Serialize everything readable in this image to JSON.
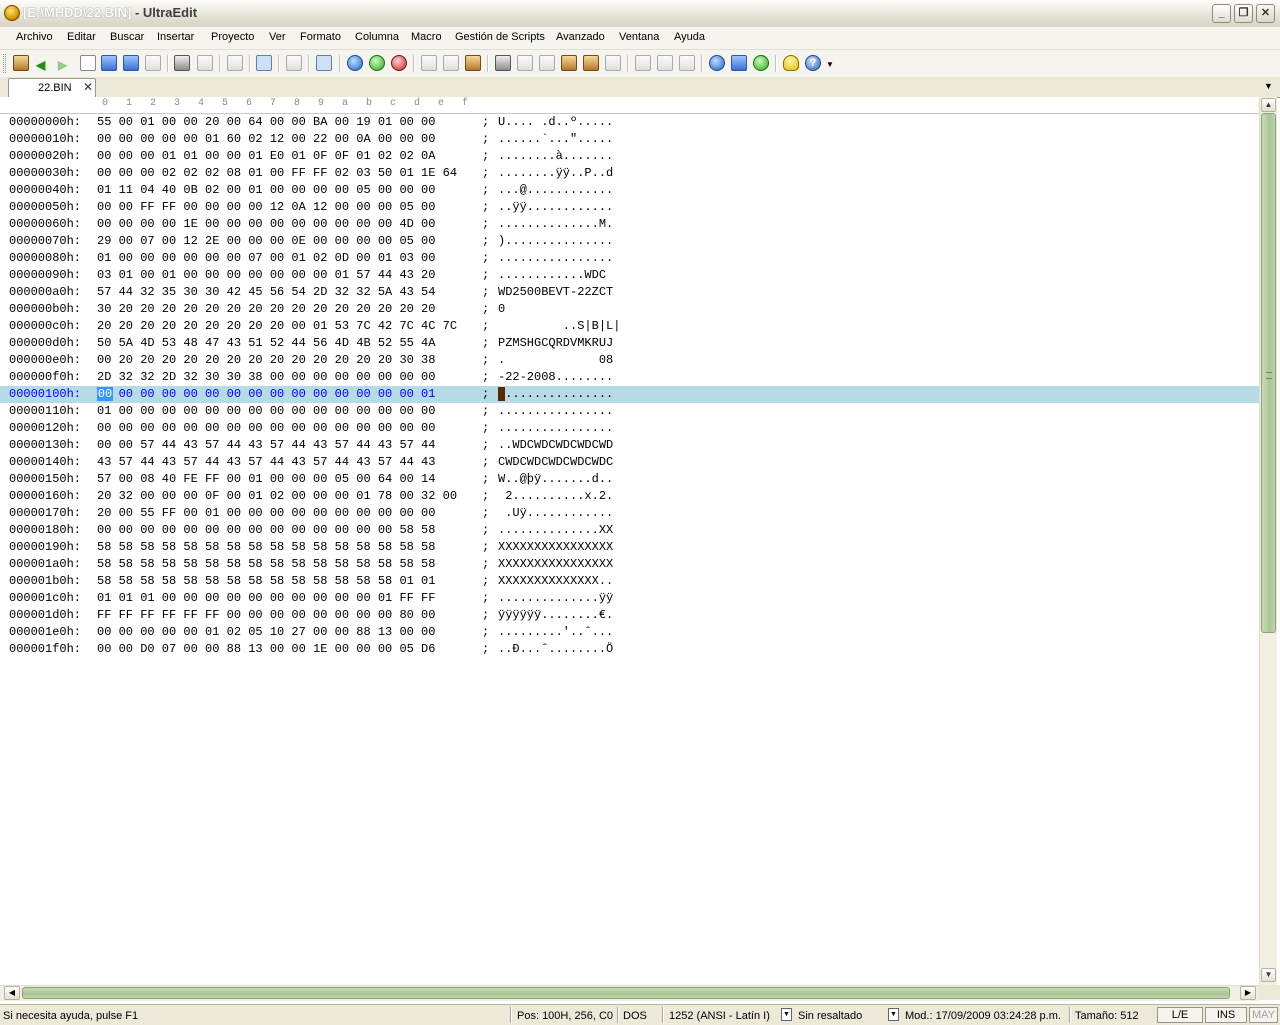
{
  "window": {
    "title_path": "[E:\\MHDD\\22.BIN]",
    "title_app": " - UltraEdit",
    "min_glyph": "_",
    "max_glyph": "❐",
    "close_glyph": "✕"
  },
  "menu": [
    "Archivo",
    "Editar",
    "Buscar",
    "Insertar",
    "Proyecto",
    "Ver",
    "Formato",
    "Columna",
    "Macro",
    "Gestión de Scripts",
    "Avanzado",
    "Ventana",
    "Ayuda"
  ],
  "tab": {
    "label": "22.BIN",
    "close": "✕"
  },
  "ruler": [
    "0",
    "1",
    "2",
    "3",
    "4",
    "5",
    "6",
    "7",
    "8",
    "9",
    "a",
    "b",
    "c",
    "d",
    "e",
    "f"
  ],
  "hex_rows": [
    {
      "addr": "00000000h:",
      "hex": "55 00 01 00 00 20 00 64 00 00 BA 00 19 01 00 00",
      "sep": ";",
      "ascii": "U.... .d..º....."
    },
    {
      "addr": "00000010h:",
      "hex": "00 00 00 00 00 01 60 02 12 00 22 00 0A 00 00 00",
      "sep": ";",
      "ascii": "......`...\"....."
    },
    {
      "addr": "00000020h:",
      "hex": "00 00 00 01 01 00 00 01 E0 01 0F 0F 01 02 02 0A",
      "sep": ";",
      "ascii": "........à......."
    },
    {
      "addr": "00000030h:",
      "hex": "00 00 00 02 02 02 08 01 00 FF FF 02 03 50 01 1E 64",
      "sep": ";",
      "ascii": "........ÿÿ..P..d"
    },
    {
      "addr": "00000040h:",
      "hex": "01 11 04 40 0B 02 00 01 00 00 00 00 05 00 00 00",
      "sep": ";",
      "ascii": "...@............"
    },
    {
      "addr": "00000050h:",
      "hex": "00 00 FF FF 00 00 00 00 12 0A 12 00 00 00 05 00",
      "sep": ";",
      "ascii": "..ÿÿ............"
    },
    {
      "addr": "00000060h:",
      "hex": "00 00 00 00 1E 00 00 00 00 00 00 00 00 00 4D 00",
      "sep": ";",
      "ascii": "..............M."
    },
    {
      "addr": "00000070h:",
      "hex": "29 00 07 00 12 2E 00 00 00 0E 00 00 00 00 05 00",
      "sep": ";",
      "ascii": ")..............."
    },
    {
      "addr": "00000080h:",
      "hex": "01 00 00 00 00 00 00 07 00 01 02 0D 00 01 03 00",
      "sep": ";",
      "ascii": "................"
    },
    {
      "addr": "00000090h:",
      "hex": "03 01 00 01 00 00 00 00 00 00 00 01 57 44 43 20",
      "sep": ";",
      "ascii": "............WDC "
    },
    {
      "addr": "000000a0h:",
      "hex": "57 44 32 35 30 30 42 45 56 54 2D 32 32 5A 43 54",
      "sep": ";",
      "ascii": "WD2500BEVT-22ZCT"
    },
    {
      "addr": "000000b0h:",
      "hex": "30 20 20 20 20 20 20 20 20 20 20 20 20 20 20 20",
      "sep": ";",
      "ascii": "0               "
    },
    {
      "addr": "000000c0h:",
      "hex": "20 20 20 20 20 20 20 20 20 00 01 53 7C 42 7C 4C 7C",
      "sep": ";",
      "ascii": "         ..S|B|L|"
    },
    {
      "addr": "000000d0h:",
      "hex": "50 5A 4D 53 48 47 43 51 52 44 56 4D 4B 52 55 4A",
      "sep": ";",
      "ascii": "PZMSHGCQRDVMKRUJ"
    },
    {
      "addr": "000000e0h:",
      "hex": "00 20 20 20 20 20 20 20 20 20 20 20 20 20 30 38",
      "sep": ";",
      "ascii": ".             08"
    },
    {
      "addr": "000000f0h:",
      "hex": "2D 32 32 2D 32 30 30 38 00 00 00 00 00 00 00 00",
      "sep": ";",
      "ascii": "-22-2008........"
    },
    {
      "addr": "00000100h:",
      "hex": "00 00 00 00 00 00 00 00 00 00 00 00 00 00 00 01",
      "sep": ";",
      "ascii": "................"
    },
    {
      "addr": "00000110h:",
      "hex": "01 00 00 00 00 00 00 00 00 00 00 00 00 00 00 00",
      "sep": ";",
      "ascii": "................"
    },
    {
      "addr": "00000120h:",
      "hex": "00 00 00 00 00 00 00 00 00 00 00 00 00 00 00 00",
      "sep": ";",
      "ascii": "................"
    },
    {
      "addr": "00000130h:",
      "hex": "00 00 57 44 43 57 44 43 57 44 43 57 44 43 57 44",
      "sep": ";",
      "ascii": "..WDCWDCWDCWDCWD"
    },
    {
      "addr": "00000140h:",
      "hex": "43 57 44 43 57 44 43 57 44 43 57 44 43 57 44 43",
      "sep": ";",
      "ascii": "CWDCWDCWDCWDCWDC"
    },
    {
      "addr": "00000150h:",
      "hex": "57 00 08 40 FE FF 00 01 00 00 00 05 00 64 00 14",
      "sep": ";",
      "ascii": "W..@þÿ.......d.."
    },
    {
      "addr": "00000160h:",
      "hex": "20 32 00 00 00 0F 00 01 02 00 00 00 01 78 00 32 00",
      "sep": ";",
      "ascii": " 2..........x.2."
    },
    {
      "addr": "00000170h:",
      "hex": "20 00 55 FF 00 01 00 00 00 00 00 00 00 00 00 00",
      "sep": ";",
      "ascii": " .Uÿ............"
    },
    {
      "addr": "00000180h:",
      "hex": "00 00 00 00 00 00 00 00 00 00 00 00 00 00 58 58",
      "sep": ";",
      "ascii": "..............XX"
    },
    {
      "addr": "00000190h:",
      "hex": "58 58 58 58 58 58 58 58 58 58 58 58 58 58 58 58",
      "sep": ";",
      "ascii": "XXXXXXXXXXXXXXXX"
    },
    {
      "addr": "000001a0h:",
      "hex": "58 58 58 58 58 58 58 58 58 58 58 58 58 58 58 58",
      "sep": ";",
      "ascii": "XXXXXXXXXXXXXXXX"
    },
    {
      "addr": "000001b0h:",
      "hex": "58 58 58 58 58 58 58 58 58 58 58 58 58 58 01 01",
      "sep": ";",
      "ascii": "XXXXXXXXXXXXXX.."
    },
    {
      "addr": "000001c0h:",
      "hex": "01 01 01 00 00 00 00 00 00 00 00 00 00 01 FF FF",
      "sep": ";",
      "ascii": "..............ÿÿ"
    },
    {
      "addr": "000001d0h:",
      "hex": "FF FF FF FF FF FF 00 00 00 00 00 00 00 00 80 00",
      "sep": ";",
      "ascii": "ÿÿÿÿÿÿ........€."
    },
    {
      "addr": "000001e0h:",
      "hex": "00 00 00 00 00 01 02 05 10 27 00 00 88 13 00 00",
      "sep": ";",
      "ascii": ".........'..ˆ..."
    },
    {
      "addr": "000001f0h:",
      "hex": "00 00 D0 07 00 00 88 13 00 00 1E 00 00 00 05 D6",
      "sep": ";",
      "ascii": "..Ð...ˆ........Ö"
    }
  ],
  "current_row_index": 16,
  "selected_byte": "00",
  "status": {
    "help": "Si necesita ayuda, pulse F1",
    "pos": "Pos: 100H, 256, C0",
    "eol": "DOS",
    "codepage": "1252  (ANSI - Latín I)",
    "highlight": "Sin resaltado",
    "modified": "Mod.: 17/09/2009 03:24:28 p.m.",
    "size": "Tamaño: 512",
    "le": "L/E",
    "ins": "INS",
    "may": "MAY"
  }
}
